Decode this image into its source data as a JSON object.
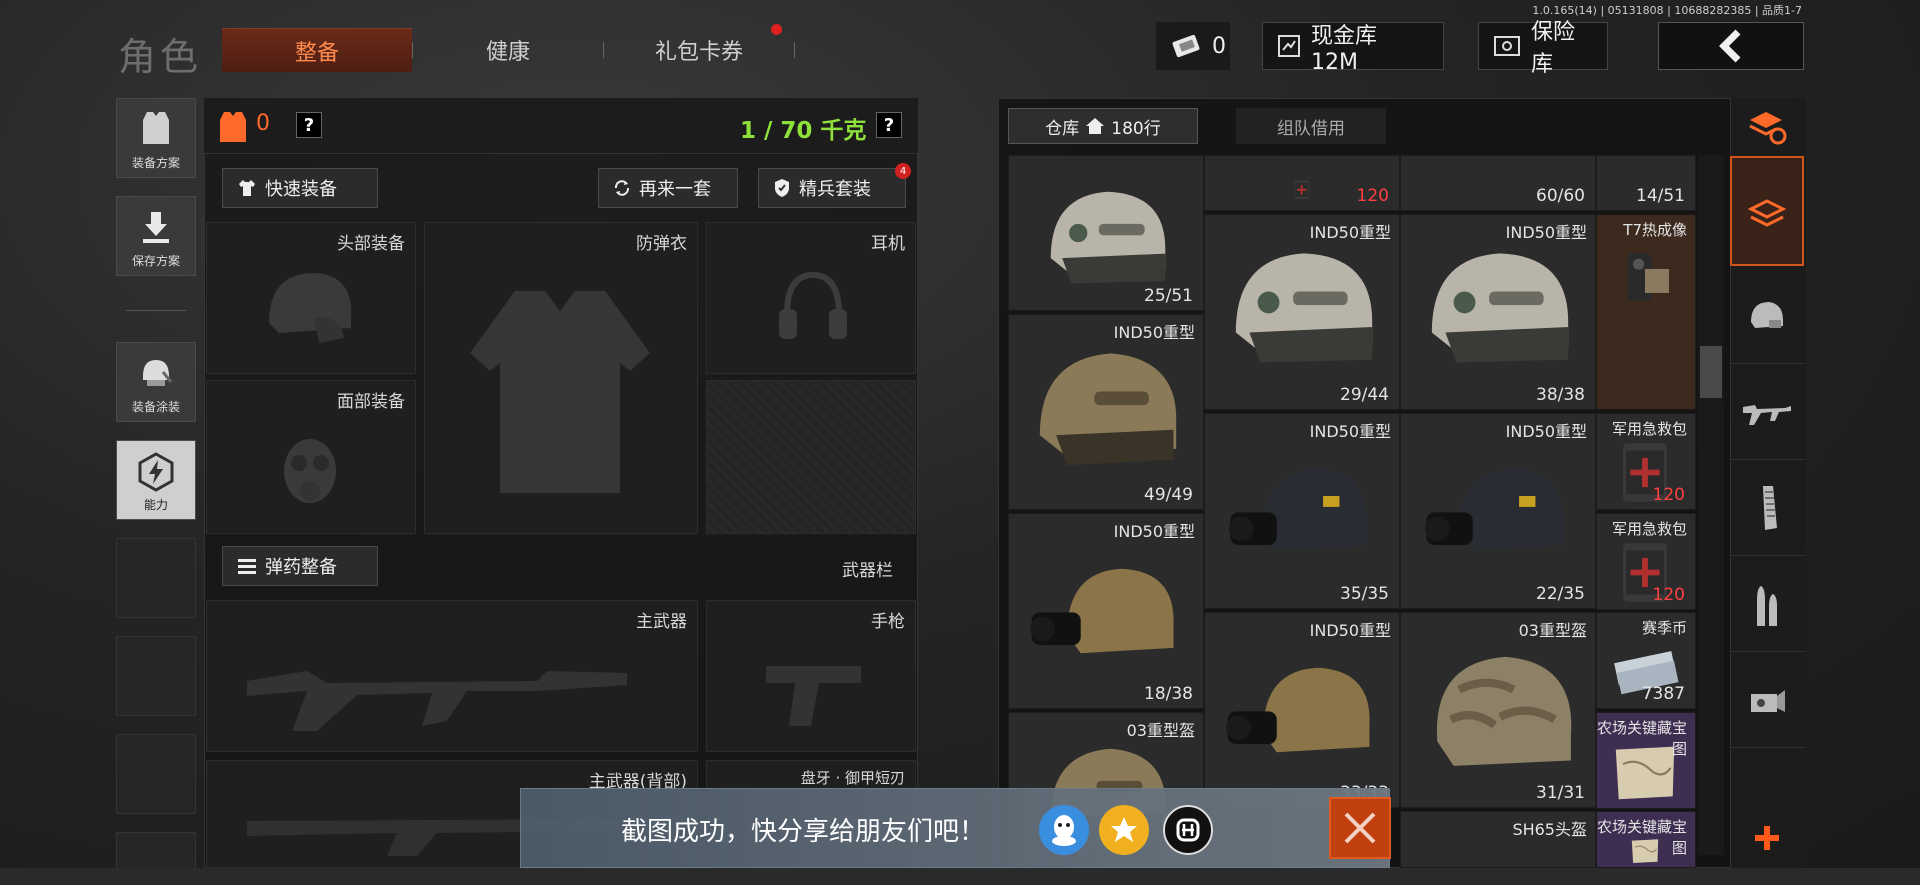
{
  "version_text": "1.0.165(14) | 05131808 | 10688282385 | 品质1-7",
  "title": "角色",
  "tabs": [
    {
      "label": "整备",
      "active": true
    },
    {
      "label": "健康",
      "active": false
    },
    {
      "label": "礼包卡券",
      "active": false,
      "dot": true
    }
  ],
  "currency": {
    "tickets": "0",
    "cash_vault": "现金库 12M",
    "safe_vault": "保险库"
  },
  "left_rail": {
    "loadout_plan": "装备方案",
    "save_plan": "保存方案",
    "skin": "装备涂装",
    "ability": "能力"
  },
  "loadout": {
    "armor_value": "0",
    "weight": "1 / 70 千克",
    "quick_equip": "快速装备",
    "again": "再来一套",
    "elite": "精兵套装",
    "elite_badge": "4",
    "slots": {
      "head": "头部装备",
      "vest": "防弹衣",
      "headset": "耳机",
      "face": "面部装备",
      "ammo_btn": "弹药整备",
      "weapon_bar": "武器栏",
      "primary": "主武器",
      "pistol": "手枪",
      "primary_back": "主武器(背部)",
      "melee": "盘牙 · 御甲短刃"
    }
  },
  "warehouse": {
    "tab_storage": "仓库",
    "rows": "180行",
    "tab_team": "组队借用",
    "cells": [
      {
        "name": "",
        "count": "25/51"
      },
      {
        "name": "",
        "count": "120",
        "red": true
      },
      {
        "name": "",
        "count": "60/60"
      },
      {
        "name": "",
        "count": "14/51"
      },
      {
        "name": "IND50重型",
        "count": "29/44"
      },
      {
        "name": "IND50重型",
        "count": "38/38"
      },
      {
        "name": "T7热成像",
        "count": ""
      },
      {
        "name": "IND50重型",
        "count": "49/49"
      },
      {
        "name": "IND50重型",
        "count": "35/35"
      },
      {
        "name": "IND50重型",
        "count": "22/35"
      },
      {
        "name": "军用急救包",
        "count": "120",
        "red": true
      },
      {
        "name": "IND50重型",
        "count": "18/38"
      },
      {
        "name": "军用急救包",
        "count": "120",
        "red": true
      },
      {
        "name": "IND50重型",
        "count": "33/33"
      },
      {
        "name": "03重型盔",
        "count": "31/31"
      },
      {
        "name": "赛季币",
        "count": "7387"
      },
      {
        "name": "03重型盔",
        "count": ""
      },
      {
        "name": "农场关键藏宝图",
        "count": ""
      },
      {
        "name": "SH65头盔",
        "count": ""
      },
      {
        "name": "农场关键藏宝图",
        "count": ""
      }
    ]
  },
  "toast": {
    "text": "截图成功，快分享给朋友们吧！"
  }
}
